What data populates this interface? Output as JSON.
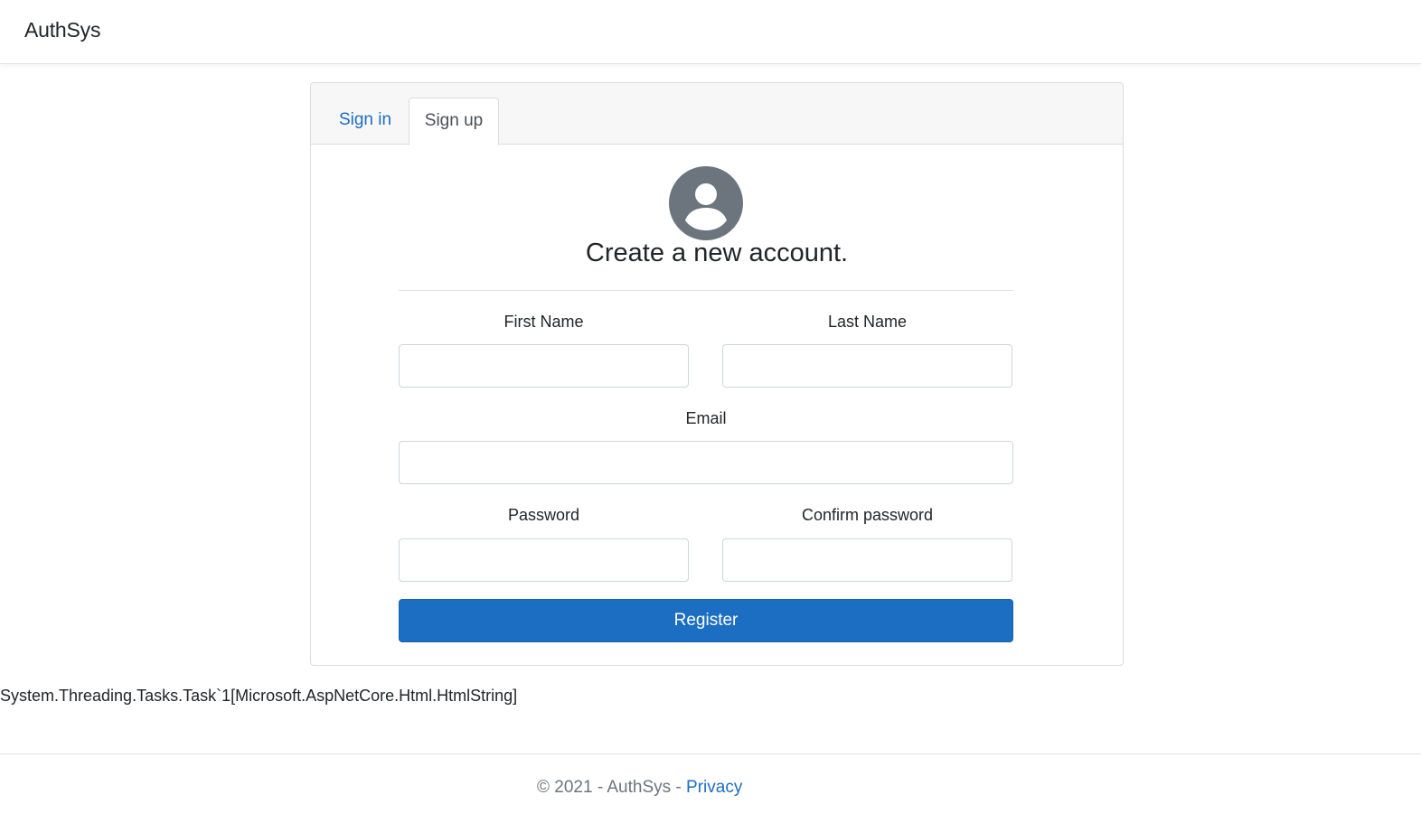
{
  "navbar": {
    "brand": "AuthSys"
  },
  "tabs": {
    "signin": "Sign in",
    "signup": "Sign up"
  },
  "form": {
    "heading": "Create a new account.",
    "first_name_label": "First Name",
    "last_name_label": "Last Name",
    "email_label": "Email",
    "password_label": "Password",
    "confirm_password_label": "Confirm password",
    "first_name_value": "",
    "last_name_value": "",
    "email_value": "",
    "password_value": "",
    "confirm_password_value": "",
    "register_label": "Register"
  },
  "debug_text": "System.Threading.Tasks.Task`1[Microsoft.AspNetCore.Html.HtmlString]",
  "footer": {
    "copyright": "© 2021 - AuthSys - ",
    "privacy_link": "Privacy"
  },
  "icons": {
    "avatar": "user-circle-icon"
  },
  "colors": {
    "primary": "#1b6ec2",
    "avatar_bg": "#6c757d"
  }
}
